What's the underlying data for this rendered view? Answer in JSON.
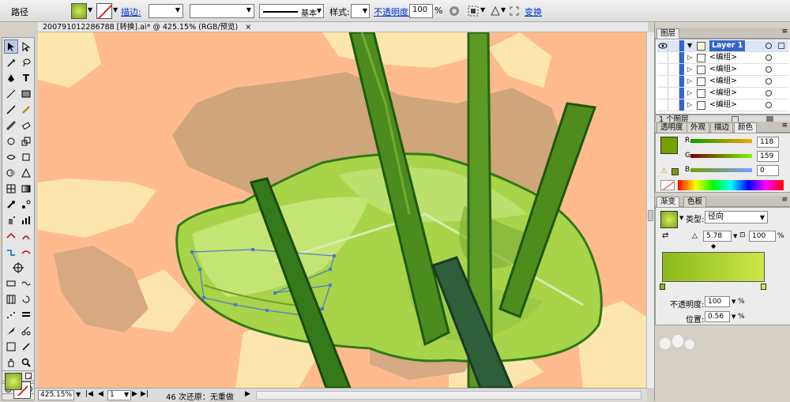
{
  "control_bar": {
    "object_type": "路径",
    "stroke_link": "描边:",
    "stroke_weight": "",
    "brush_style": "基本",
    "style_label": "样式:",
    "opacity_link": "不透明度:",
    "opacity_value": "100",
    "opacity_unit": "%",
    "transform_link": "变换"
  },
  "document_tab": {
    "title": "200791012286788 [转换].ai* @ 425.15% (RGB/预览)"
  },
  "status_bar": {
    "zoom": "425.15%",
    "page": "1",
    "message": "46 次还原：无重做"
  },
  "layers_panel": {
    "tab": "图层",
    "layers": [
      {
        "name": "Layer 1",
        "selected": true
      },
      {
        "name": "<编组>"
      },
      {
        "name": "<编组>"
      },
      {
        "name": "<编组>"
      },
      {
        "name": "<编组>"
      },
      {
        "name": "<编组>"
      }
    ],
    "footer": "1 个图层"
  },
  "color_panel": {
    "tabs": [
      "透明度",
      "外观",
      "描边",
      "颜色"
    ],
    "active_tab": "颜色",
    "R": "118",
    "G": "159",
    "B": "0",
    "R_label": "R",
    "G_label": "G",
    "B_label": "B",
    "fill_color": "#769f00"
  },
  "gradient_panel": {
    "tabs": [
      "渐变",
      "色板"
    ],
    "active_tab": "渐变",
    "type_label": "类型:",
    "type_value": "径向",
    "angle_value": "5.78",
    "aspect_value": "100",
    "aspect_unit": "%",
    "opacity_label": "不透明度:",
    "opacity_value": "100",
    "opacity_unit": "%",
    "position_label": "位置:",
    "position_value": "0.56",
    "position_unit": "%",
    "gradient_start": "#8cb81b",
    "gradient_end": "#cde84a"
  }
}
